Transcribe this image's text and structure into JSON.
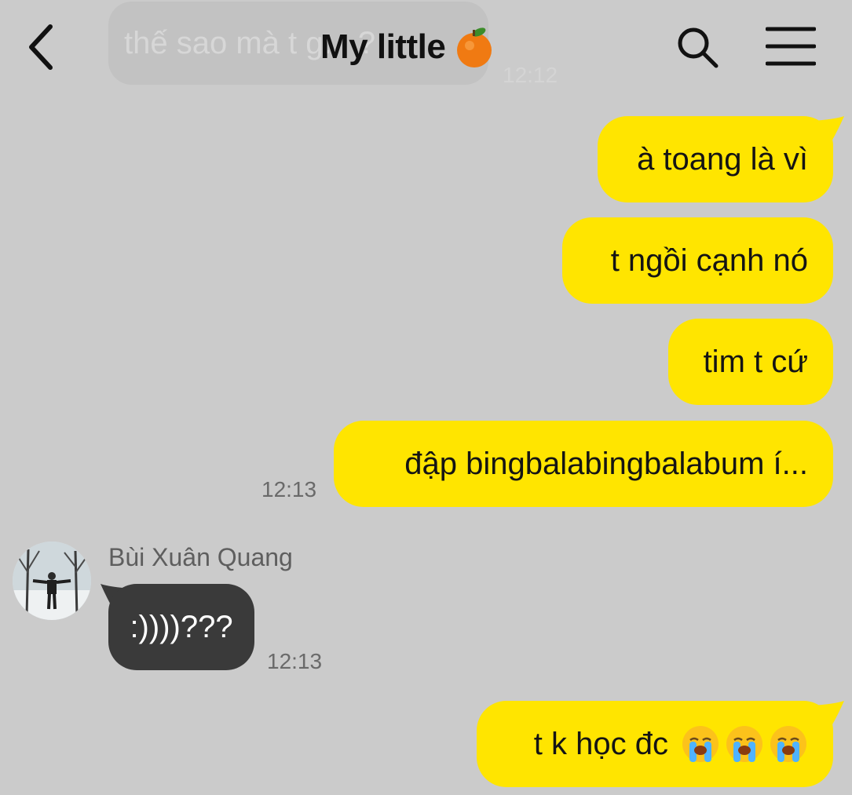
{
  "header": {
    "title": "My little",
    "title_emoji": "tangerine-icon",
    "back_icon": "back-chevron-icon",
    "search_icon": "search-icon",
    "menu_icon": "menu-icon"
  },
  "previous_message": {
    "text": "thế sao mà t g... ?",
    "time": "12:12"
  },
  "messages": [
    {
      "from": "me",
      "text": "à toang là vì"
    },
    {
      "from": "me",
      "text": "t ngồi cạnh nó"
    },
    {
      "from": "me",
      "text": "tim t cứ"
    },
    {
      "from": "me",
      "text": "đập bingbalabingbalabum í...",
      "time": "12:13"
    },
    {
      "from": "them",
      "sender": "Bùi Xuân Quang",
      "text": ":))))???",
      "time": "12:13"
    },
    {
      "from": "me",
      "text": "t k học đc",
      "emoji": [
        "loudly-crying-face-icon",
        "loudly-crying-face-icon",
        "loudly-crying-face-icon"
      ]
    }
  ],
  "colors": {
    "background": "#cbcbcb",
    "my_bubble": "#ffe500",
    "their_bubble": "#3a3a3a"
  }
}
